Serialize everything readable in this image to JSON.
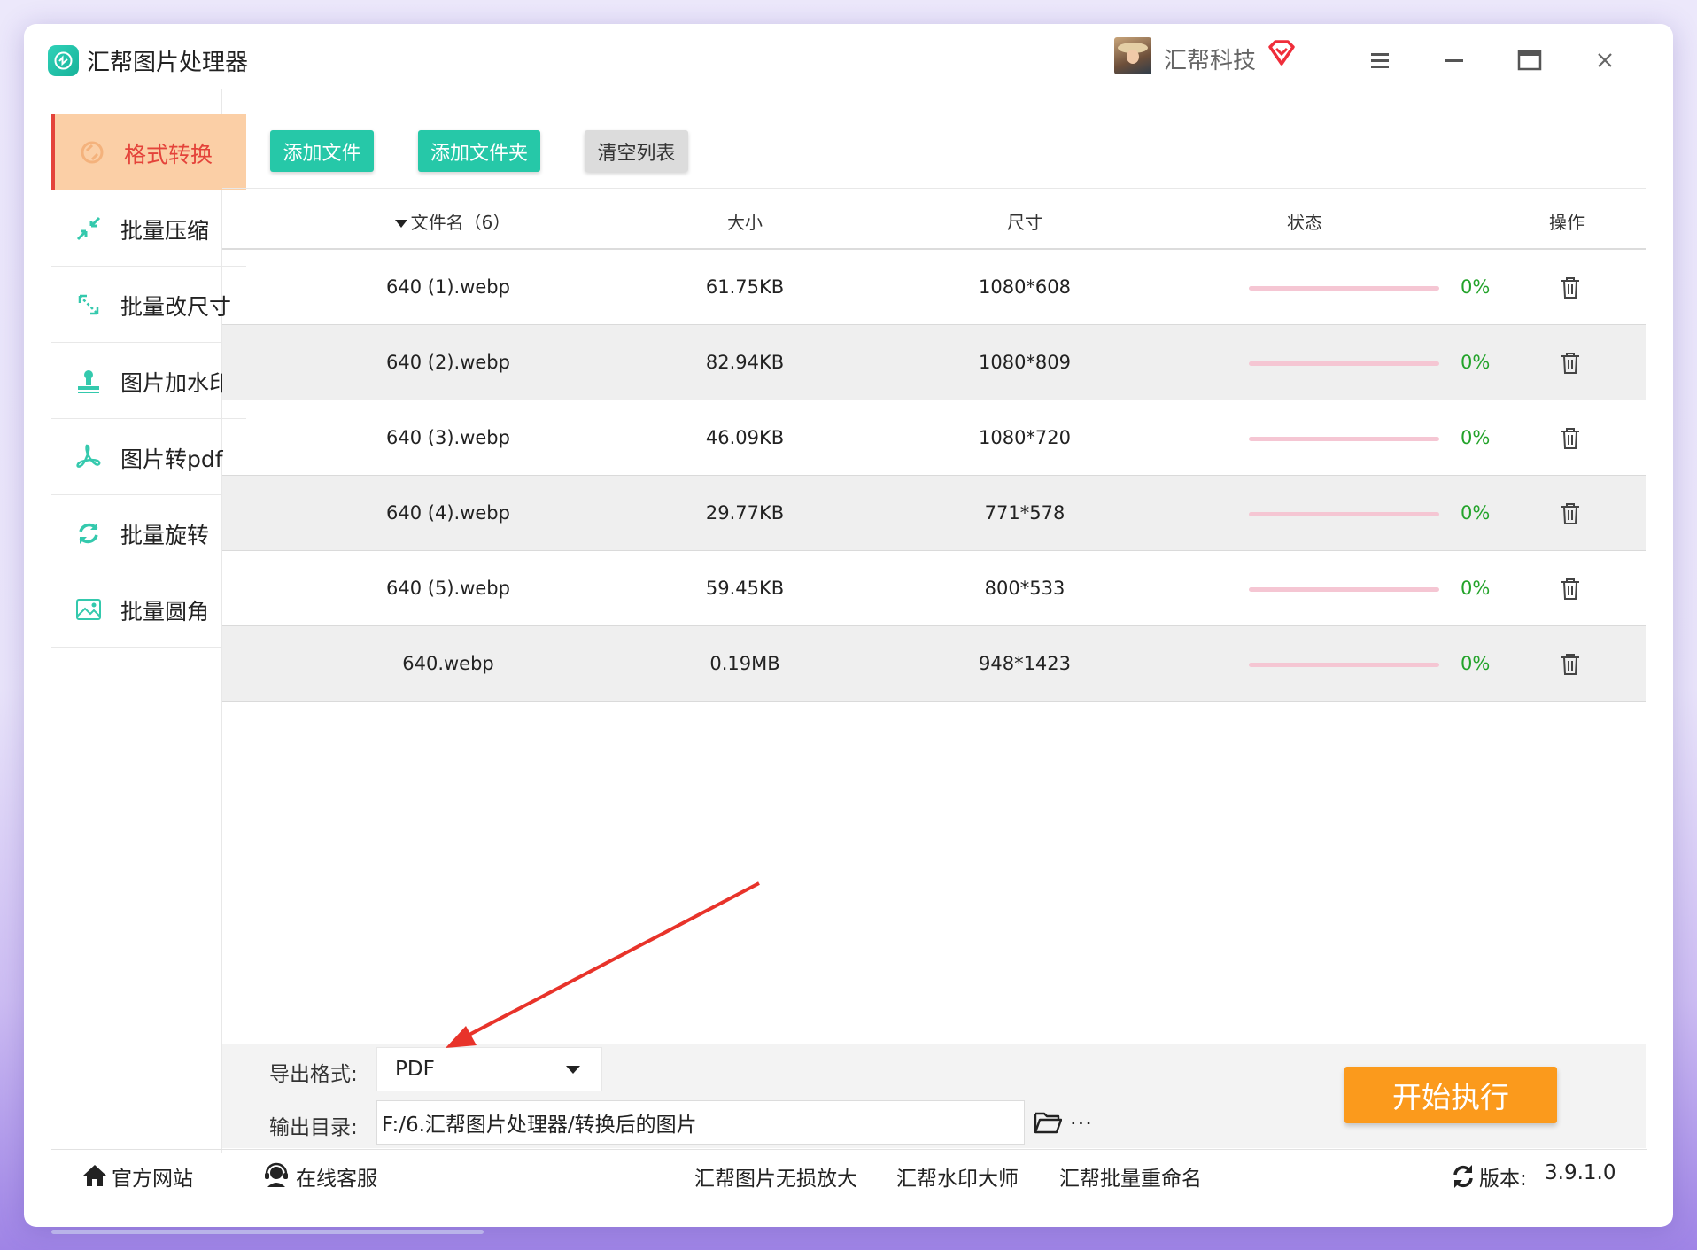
{
  "app": {
    "title": "汇帮图片处理器"
  },
  "user": {
    "name": "汇帮科技"
  },
  "sidebar": {
    "items": [
      {
        "label": "格式转换",
        "icon": "format-convert-icon",
        "active": true
      },
      {
        "label": "批量压缩",
        "icon": "compress-icon"
      },
      {
        "label": "批量改尺寸",
        "icon": "resize-icon"
      },
      {
        "label": "图片加水印",
        "icon": "watermark-icon"
      },
      {
        "label": "图片转pdf",
        "icon": "pdf-icon"
      },
      {
        "label": "批量旋转",
        "icon": "rotate-icon"
      },
      {
        "label": "批量圆角",
        "icon": "rounded-corner-icon"
      }
    ]
  },
  "toolbar": {
    "add_file": "添加文件",
    "add_folder": "添加文件夹",
    "clear_list": "清空列表"
  },
  "table": {
    "headers": {
      "filename": "文件名（6）",
      "size": "大小",
      "dimensions": "尺寸",
      "status": "状态",
      "actions": "操作"
    },
    "rows": [
      {
        "name": "640 (1).webp",
        "size": "61.75KB",
        "dims": "1080*608",
        "progress": "0%"
      },
      {
        "name": "640 (2).webp",
        "size": "82.94KB",
        "dims": "1080*809",
        "progress": "0%"
      },
      {
        "name": "640 (3).webp",
        "size": "46.09KB",
        "dims": "1080*720",
        "progress": "0%"
      },
      {
        "name": "640 (4).webp",
        "size": "29.77KB",
        "dims": "771*578",
        "progress": "0%"
      },
      {
        "name": "640 (5).webp",
        "size": "59.45KB",
        "dims": "800*533",
        "progress": "0%"
      },
      {
        "name": "640.webp",
        "size": "0.19MB",
        "dims": "948*1423",
        "progress": "0%"
      }
    ]
  },
  "export": {
    "format_label": "导出格式:",
    "format_value": "PDF",
    "dir_label": "输出目录:",
    "dir_value": "F:/6.汇帮图片处理器/转换后的图片",
    "more": "···"
  },
  "start_button": "开始执行",
  "footer": {
    "website": "官方网站",
    "support": "在线客服",
    "link1": "汇帮图片无损放大",
    "link2": "汇帮水印大师",
    "link3": "汇帮批量重命名",
    "version_label": "版本:",
    "version": "3.9.1.0"
  },
  "colors": {
    "accent_teal": "#26c8a8",
    "active_bg": "#fbcfa6",
    "active_text": "#e4433a",
    "start_orange": "#fb9a1c",
    "progress_track": "#f5c6d3",
    "progress_text": "#23a32a",
    "annotation_arrow": "#e8332a"
  }
}
